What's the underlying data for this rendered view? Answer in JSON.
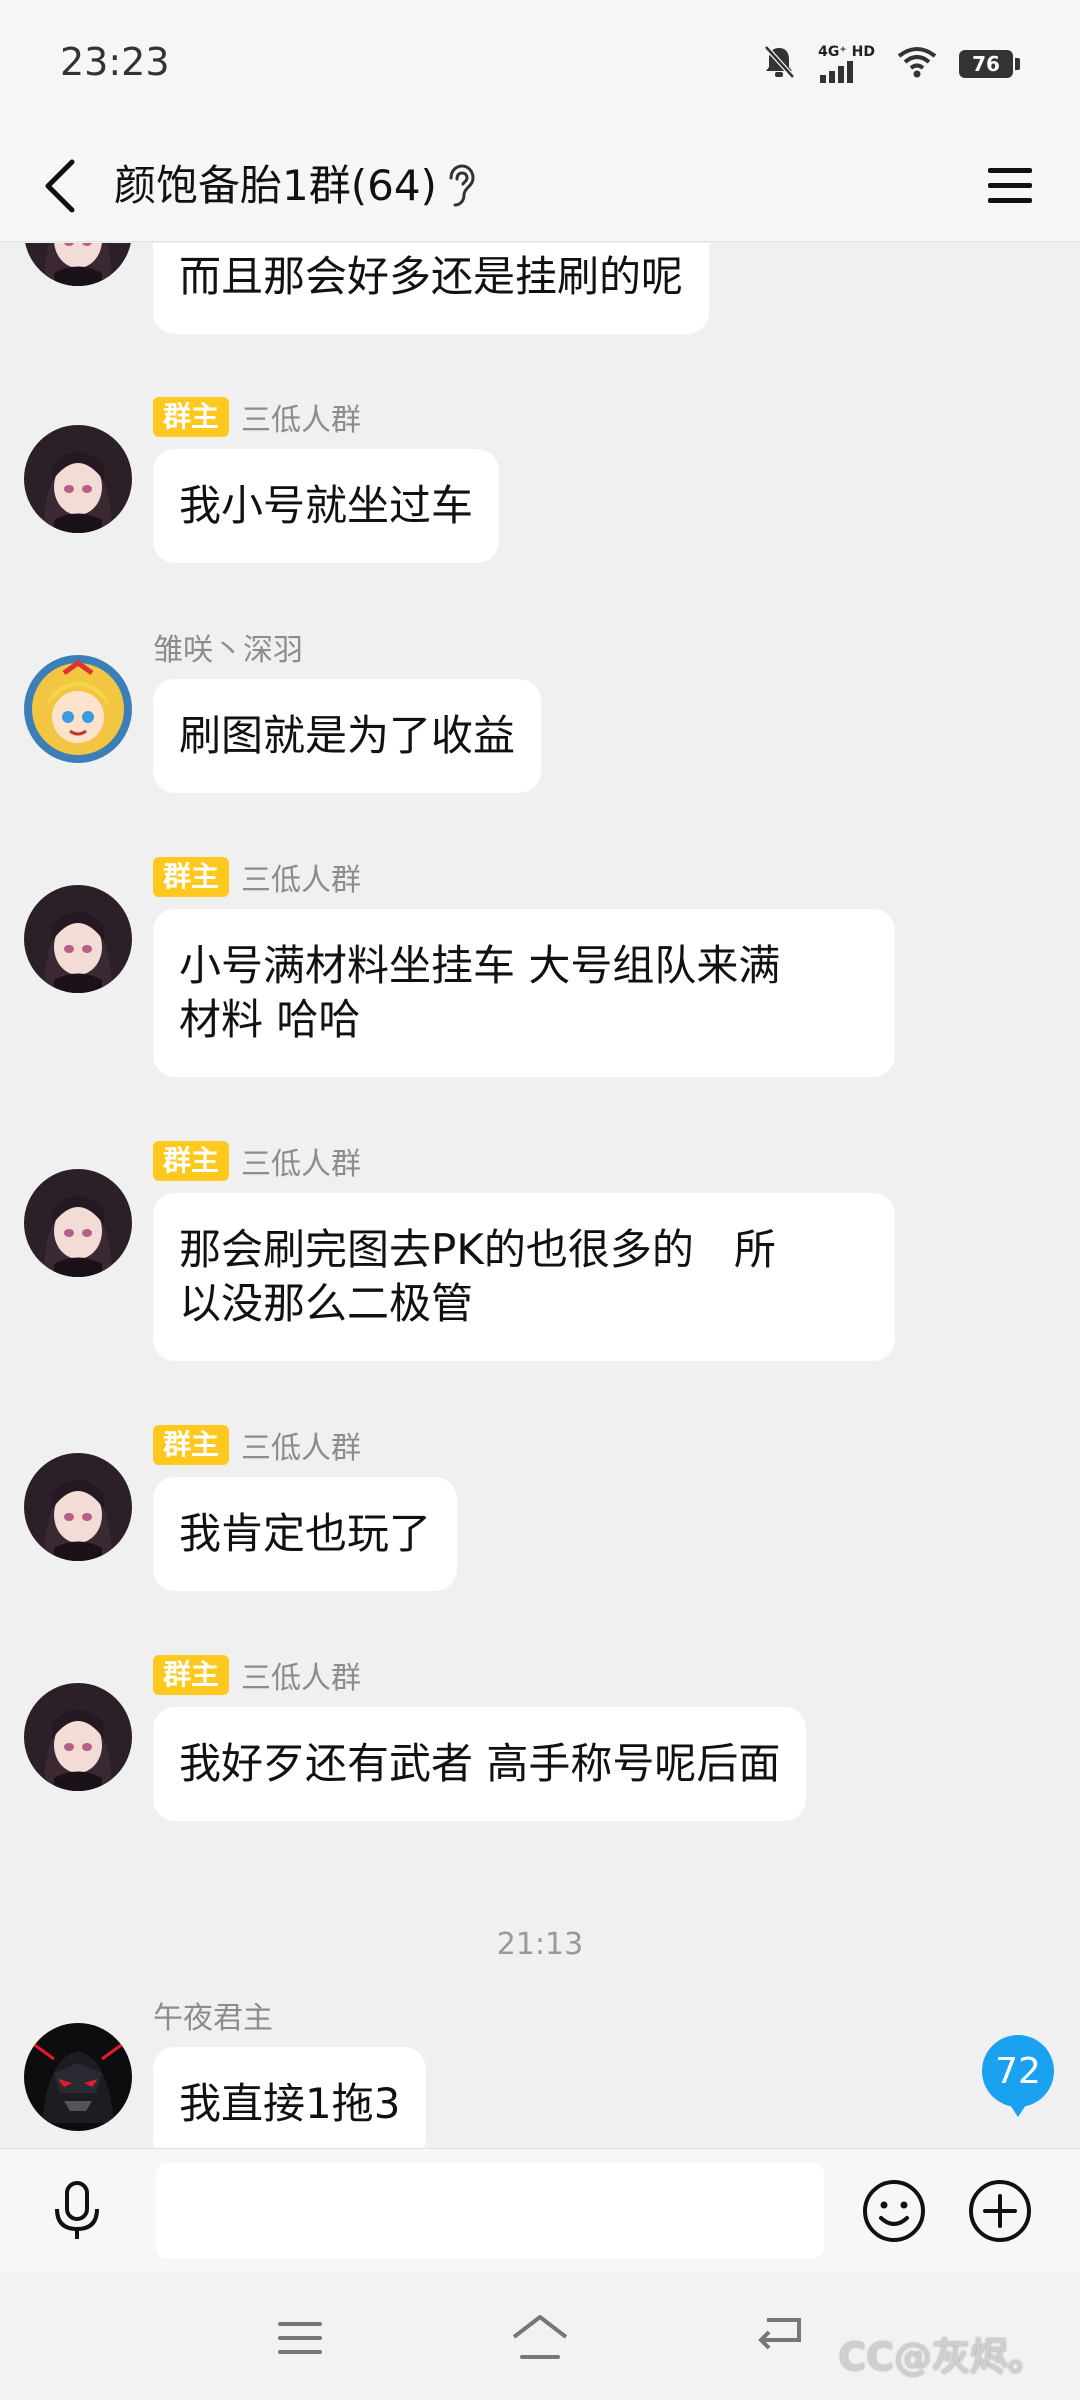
{
  "status": {
    "time": "23:23",
    "network_label": "4G⁺ HD",
    "battery": "76"
  },
  "header": {
    "title": "颜饱备胎1群(64)"
  },
  "messages": [
    {
      "sender": "",
      "text": "而且那会好多还是挂刷的呢"
    },
    {
      "badge": "群主",
      "sender": "三低人群",
      "text": "我小号就坐过车"
    },
    {
      "sender": "雏咲丶深羽",
      "text": "刷图就是为了收益"
    },
    {
      "badge": "群主",
      "sender": "三低人群",
      "text_lines": [
        "小号满材料坐挂车 大号组队来满",
        "材料 哈哈"
      ]
    },
    {
      "badge": "群主",
      "sender": "三低人群",
      "text_lines": [
        "那会刷完图去PK的也很多的   所",
        "以没那么二极管"
      ]
    },
    {
      "badge": "群主",
      "sender": "三低人群",
      "text": "我肯定也玩了"
    },
    {
      "badge": "群主",
      "sender": "三低人群",
      "text": "我好歹还有武者 高手称号呢后面"
    },
    {
      "sender": "午夜君主",
      "text": "我直接1拖3"
    }
  ],
  "time_separator": "21:13",
  "unread_count": "72",
  "input": {
    "placeholder": ""
  },
  "watermark": "CC@灰烬。",
  "colors": {
    "owner_badge": "#ffc81e",
    "unread_badge": "#1aa2f0",
    "bubble": "#ffffff",
    "background": "#f0f0f0"
  },
  "icons": [
    "back-arrow-icon",
    "ear-icon",
    "hamburger-menu-icon",
    "microphone-icon",
    "emoji-icon",
    "plus-icon",
    "nav-menu-icon",
    "nav-home-icon",
    "nav-back-icon"
  ]
}
